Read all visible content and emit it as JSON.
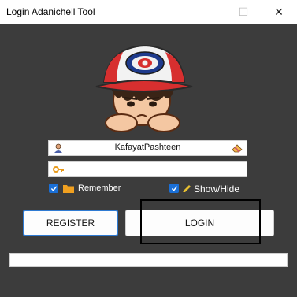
{
  "window": {
    "title": "Login Adanichell Tool"
  },
  "controls": {
    "minimize_icon": "minimize-icon",
    "maximize_icon": "maximize-icon",
    "close_icon": "close-icon"
  },
  "form": {
    "username_value": "KafayatPashteen",
    "password_value": "",
    "remember_label": "Remember",
    "remember_checked": true,
    "showhide_label": "Show/Hide",
    "showhide_checked": true
  },
  "buttons": {
    "register_label": "REGISTER",
    "login_label": "LOGIN"
  },
  "progress": {
    "value": 0
  },
  "colors": {
    "background": "#3c3c3c",
    "accent": "#1a6fd6",
    "register_border": "#2f7bd3"
  }
}
